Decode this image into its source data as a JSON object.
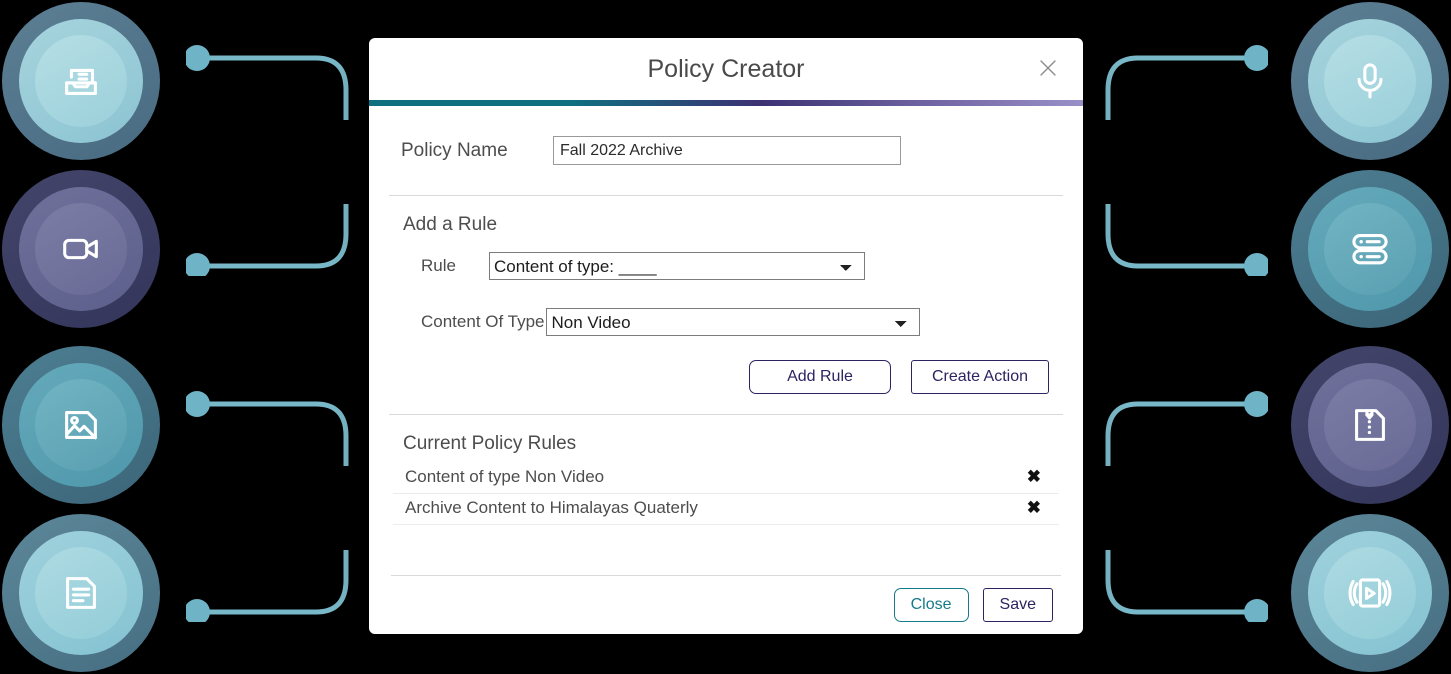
{
  "dialog": {
    "title": "Policy Creator",
    "close_icon": "close-x-icon",
    "policy_name_label": "Policy Name",
    "policy_name_value": "Fall 2022 Archive",
    "policy_name_placeholder": "",
    "add_rule_section_title": "Add a Rule",
    "rule_label": "Rule",
    "rule_value": "Content of type: ____",
    "rule_options": [
      "Content of type: ____"
    ],
    "content_type_label": "Content Of Type",
    "content_type_value": "Non Video",
    "content_type_options": [
      "Non Video"
    ],
    "add_rule_button": "Add Rule",
    "create_action_button": "Create Action",
    "current_rules_title": "Current Policy Rules",
    "rules": [
      {
        "text": "Content of type Non Video",
        "delete_icon": "✖"
      },
      {
        "text": "Archive Content to Himalayas Quaterly",
        "delete_icon": "✖"
      }
    ],
    "close_button": "Close",
    "save_button": "Save"
  },
  "colors": {
    "accent_teal": "#0f7080",
    "accent_purple_dark": "#3c3172",
    "accent_purple_light": "#9a90c8",
    "button_purple": "#2d2361",
    "button_teal": "#157a8c",
    "connector_teal": "#79b8c8",
    "connector_dot": "#6fb3c6",
    "background": "#000000"
  },
  "badges": {
    "left": [
      {
        "icon": "inbox-archive-icon",
        "style": "tealLight"
      },
      {
        "icon": "video-camera-icon",
        "style": "purple"
      },
      {
        "icon": "image-photo-icon",
        "style": "tealMid"
      },
      {
        "icon": "document-text-icon",
        "style": "tealSoft"
      }
    ],
    "right": [
      {
        "icon": "microphone-icon",
        "style": "tealLight"
      },
      {
        "icon": "server-database-icon",
        "style": "tealMid"
      },
      {
        "icon": "zip-archive-file-icon",
        "style": "purple"
      },
      {
        "icon": "video-player-icon",
        "style": "tealSoft"
      }
    ]
  }
}
